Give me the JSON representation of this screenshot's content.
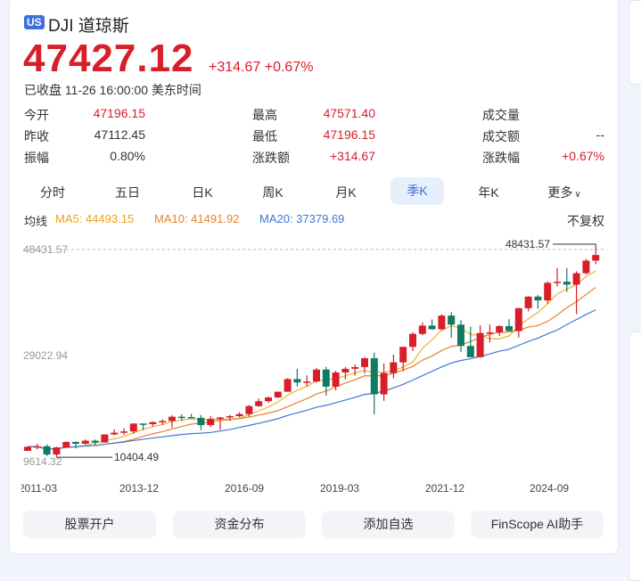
{
  "header": {
    "market_badge": "US",
    "name": "DJI 道琼斯",
    "price": "47427.12",
    "change": "+314.67",
    "change_pct": "+0.67%",
    "status": "已收盘 11-26 16:00:00 美东时间"
  },
  "stats": [
    {
      "label": "今开",
      "value": "47196.15",
      "color": "red"
    },
    {
      "label": "最高",
      "value": "47571.40",
      "color": "red"
    },
    {
      "label": "成交量",
      "value": "",
      "color": "black"
    },
    {
      "label": "昨收",
      "value": "47112.45",
      "color": "black"
    },
    {
      "label": "最低",
      "value": "47196.15",
      "color": "red"
    },
    {
      "label": "成交额",
      "value": "--",
      "color": "black"
    },
    {
      "label": "振幅",
      "value": "0.80%",
      "color": "black"
    },
    {
      "label": "涨跌额",
      "value": "+314.67",
      "color": "red"
    },
    {
      "label": "涨跌幅",
      "value": "+0.67%",
      "color": "red"
    }
  ],
  "tabs": [
    "分时",
    "五日",
    "日K",
    "周K",
    "月K",
    "季K",
    "年K",
    "更多"
  ],
  "active_tab": "季K",
  "ma_legend": {
    "label": "均线",
    "ma5": "MA5: 44493.15",
    "ma10": "MA10: 41491.92",
    "ma20": "MA20: 37379.69",
    "adjust": "不复权"
  },
  "colors": {
    "up": "#d81e2a",
    "down": "#0f7b63",
    "ma5": "#f0b030",
    "ma10": "#e8822a",
    "ma20": "#3f78d0"
  },
  "buttons": [
    "股票开户",
    "资金分布",
    "添加自选",
    "FinScope AI助手"
  ],
  "chart_data": {
    "type": "candlestick",
    "y_ticks": [
      "48431.57",
      "29022.94",
      "9614.32"
    ],
    "ylim": [
      9614.32,
      48431.57
    ],
    "max_label": "48431.57",
    "min_label": "10404.49",
    "x_ticks": [
      "2011-03",
      "2013-12",
      "2016-09",
      "2019-03",
      "2021-12",
      "2024-09"
    ],
    "ohlc": [
      [
        11578,
        12420,
        11556,
        12320
      ],
      [
        12320,
        12876,
        11862,
        12414
      ],
      [
        12414,
        12753,
        10604,
        10913
      ],
      [
        10913,
        12328,
        10404.49,
        12218
      ],
      [
        12218,
        13290,
        12218,
        13212
      ],
      [
        13212,
        13338,
        12035,
        12880
      ],
      [
        12880,
        13653,
        12710,
        13437
      ],
      [
        13437,
        13661,
        12471,
        13104
      ],
      [
        13104,
        14585,
        13104,
        14579
      ],
      [
        14579,
        15542,
        14434,
        14910
      ],
      [
        14910,
        15709,
        14551,
        15130
      ],
      [
        15130,
        16588,
        14719,
        16577
      ],
      [
        16577,
        16588,
        15340,
        16458
      ],
      [
        16458,
        16978,
        16015,
        16827
      ],
      [
        16827,
        17350,
        16333,
        17043
      ],
      [
        17043,
        18103,
        15855,
        17823
      ],
      [
        17823,
        18288,
        17037,
        17776
      ],
      [
        17776,
        18351,
        17576,
        17620
      ],
      [
        17620,
        18137,
        15370,
        16285
      ],
      [
        16285,
        17977,
        15942,
        17425
      ],
      [
        17425,
        17790,
        15450,
        17685
      ],
      [
        17685,
        18168,
        17063,
        17930
      ],
      [
        17930,
        18668,
        17713,
        18308
      ],
      [
        18308,
        19988,
        17884,
        19763
      ],
      [
        19763,
        21169,
        19677,
        20663
      ],
      [
        20663,
        21535,
        20380,
        21350
      ],
      [
        21350,
        22419,
        21279,
        22405
      ],
      [
        22405,
        24876,
        22405,
        24719
      ],
      [
        24719,
        26616,
        23360,
        24103
      ],
      [
        24103,
        25399,
        23344,
        24271
      ],
      [
        24271,
        26769,
        24078,
        26458
      ],
      [
        26458,
        26952,
        21713,
        23327
      ],
      [
        23327,
        26241,
        22639,
        25929
      ],
      [
        25929,
        26955,
        24680,
        26600
      ],
      [
        26600,
        27399,
        25339,
        26917
      ],
      [
        26917,
        28702,
        25743,
        28538
      ],
      [
        28538,
        29569,
        18214,
        21917
      ],
      [
        21917,
        27581,
        20735,
        25813
      ],
      [
        25813,
        29199,
        24843,
        27782
      ],
      [
        27782,
        30637,
        26143,
        30606
      ],
      [
        30606,
        33259,
        29857,
        32982
      ],
      [
        32982,
        35091,
        32717,
        34503
      ],
      [
        34503,
        35631,
        33741,
        33844
      ],
      [
        33844,
        36565,
        33613,
        36338
      ],
      [
        36338,
        36953,
        32272,
        34678
      ],
      [
        34678,
        35492,
        29653,
        30775
      ],
      [
        30775,
        34281,
        28716,
        28726
      ],
      [
        28726,
        34596,
        28661,
        33147
      ],
      [
        33147,
        34712,
        31430,
        33274
      ],
      [
        33274,
        34589,
        32581,
        34408
      ],
      [
        34408,
        35679,
        33390,
        33508
      ],
      [
        33508,
        37778,
        32327,
        37690
      ],
      [
        37690,
        39889,
        37122,
        39807
      ],
      [
        39807,
        40077,
        37612,
        39119
      ],
      [
        39119,
        42628,
        38499,
        42330
      ],
      [
        42330,
        45074,
        41700,
        42544
      ],
      [
        42544,
        45054,
        40661,
        42002
      ],
      [
        42002,
        44449,
        36612,
        44095
      ],
      [
        44095,
        46714,
        43900,
        46398
      ],
      [
        46398,
        48431.57,
        45728,
        47427
      ]
    ]
  }
}
